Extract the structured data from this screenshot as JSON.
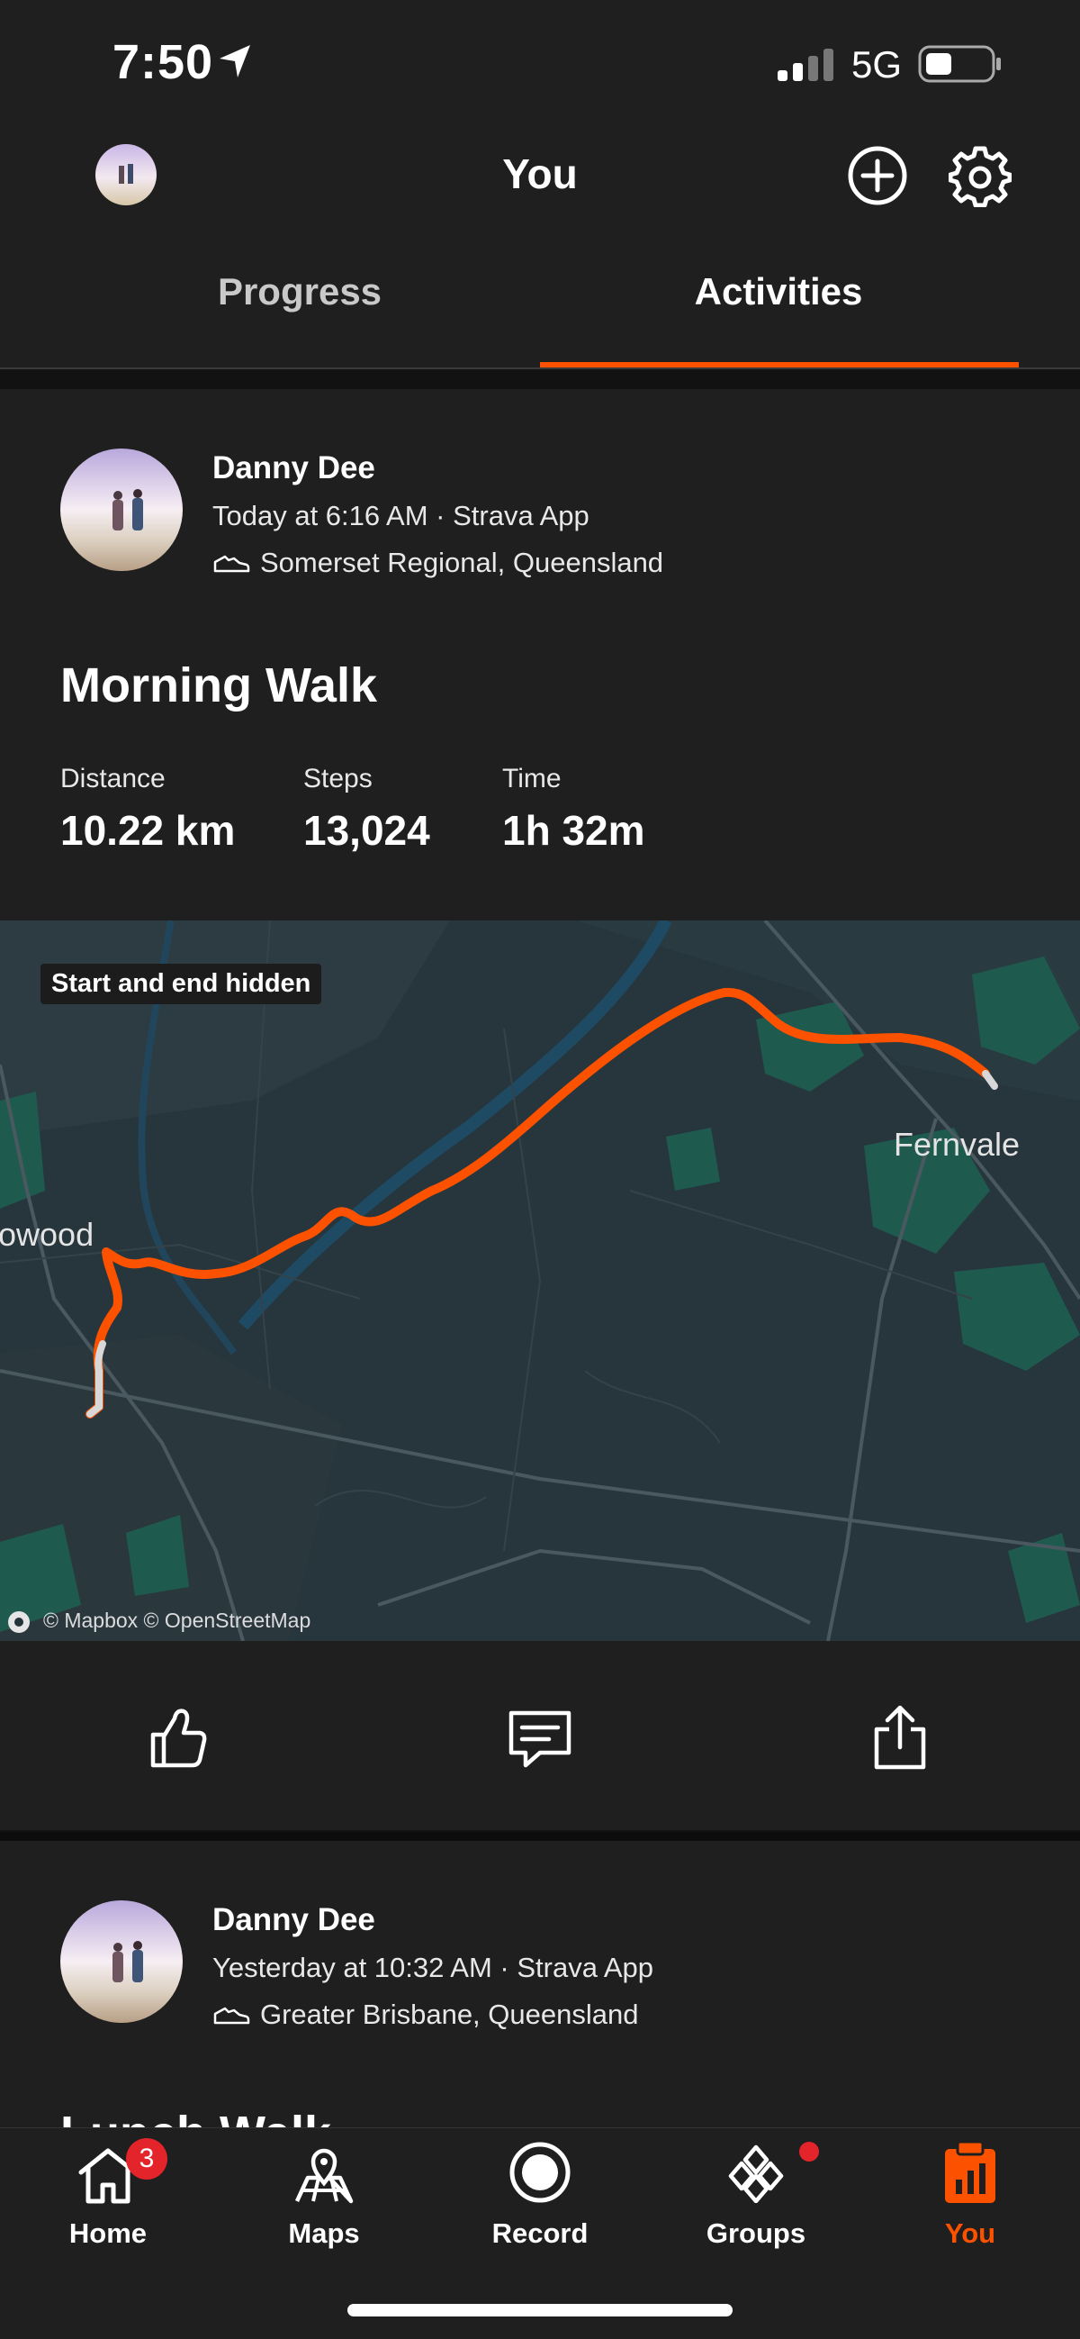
{
  "status_bar": {
    "time": "7:50",
    "network": "5G"
  },
  "header": {
    "title": "You"
  },
  "tabs": [
    {
      "label": "Progress"
    },
    {
      "label": "Activities"
    }
  ],
  "activities": [
    {
      "athlete": "Danny Dee",
      "meta": "Today at 6:16 AM · Strava App",
      "location": "Somerset Regional, Queensland",
      "title": "Morning Walk",
      "stats": [
        {
          "label": "Distance",
          "value": "10.22 km"
        },
        {
          "label": "Steps",
          "value": "13,024"
        },
        {
          "label": "Time",
          "value": "1h 32m"
        }
      ],
      "map": {
        "badge": "Start and end hidden",
        "attribution": "© Mapbox © OpenStreetMap",
        "places": [
          "owood",
          "Fernvale"
        ]
      }
    },
    {
      "athlete": "Danny Dee",
      "meta": "Yesterday at 10:32 AM · Strava App",
      "location": "Greater Brisbane, Queensland",
      "title": "Lunch Walk"
    }
  ],
  "bottom_nav": {
    "items": [
      {
        "label": "Home",
        "icon": "home-icon",
        "badge": "3"
      },
      {
        "label": "Maps",
        "icon": "map-icon"
      },
      {
        "label": "Record",
        "icon": "record-icon"
      },
      {
        "label": "Groups",
        "icon": "groups-icon"
      },
      {
        "label": "You",
        "icon": "you-icon"
      }
    ]
  },
  "colors": {
    "accent": "#fc5200",
    "background": "#121212",
    "surface": "#1f1f1f",
    "badge": "#e3242b"
  }
}
